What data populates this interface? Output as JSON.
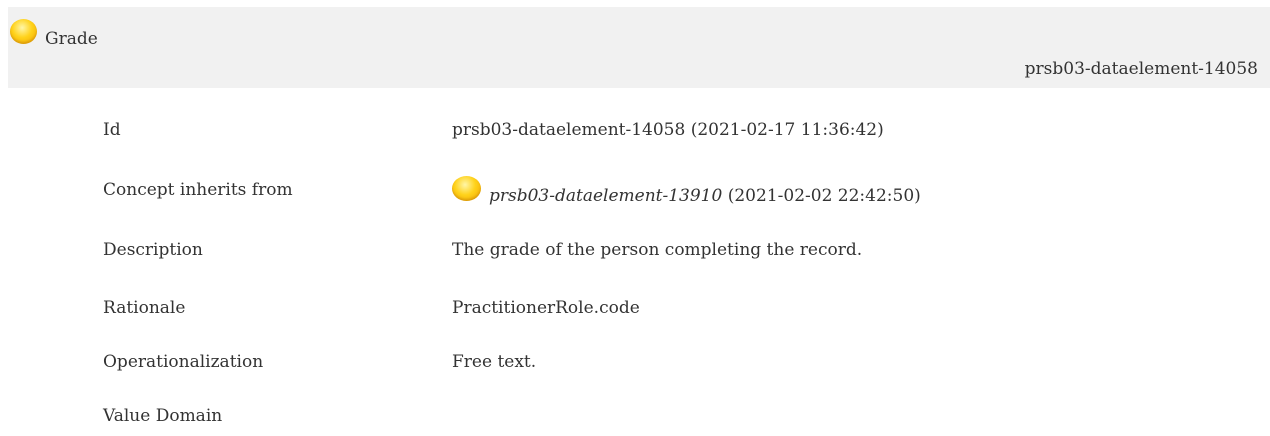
{
  "header": {
    "title": "Grade",
    "id": "prsb03-dataelement-14058",
    "icon": "concept-orb-icon"
  },
  "details": {
    "id": {
      "label": "Id",
      "value": "prsb03-dataelement-14058 (2021-02-17 11:36:42)"
    },
    "inherits": {
      "label": "Concept inherits from",
      "ref": "prsb03-dataelement-13910",
      "timestamp": "(2021-02-02 22:42:50)",
      "icon": "concept-orb-icon"
    },
    "description": {
      "label": "Description",
      "value": "The grade of the person completing the record."
    },
    "rationale": {
      "label": "Rationale",
      "value": "PractitionerRole.code"
    },
    "operationalization": {
      "label": "Operationalization",
      "value": "Free text."
    },
    "value_domain": {
      "label": "Value Domain",
      "value": ""
    }
  },
  "colors": {
    "header_bg": "#f1f1f1",
    "text": "#333333",
    "orb": "#ffd21a"
  }
}
